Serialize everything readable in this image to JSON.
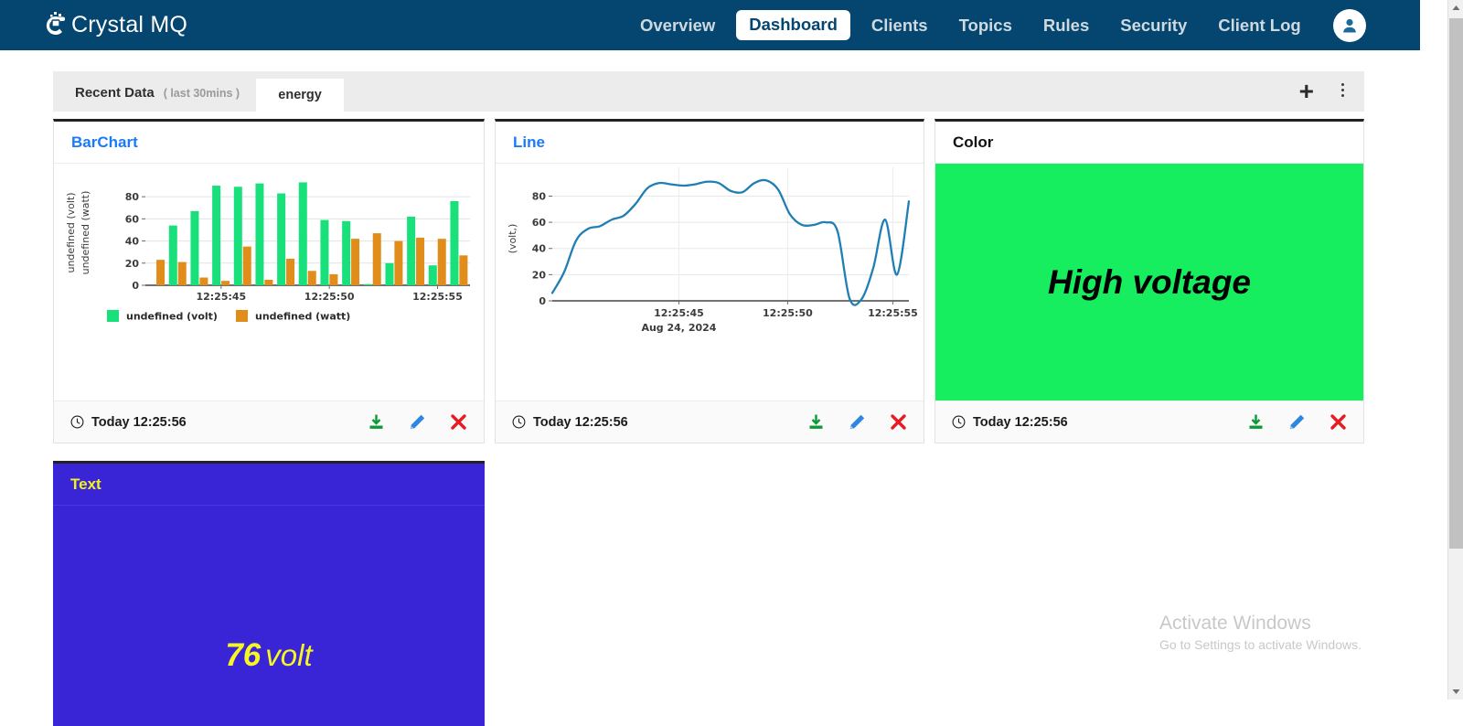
{
  "app": {
    "brand": "Crystal MQ",
    "logo_icon": "crystal-logo-icon"
  },
  "nav": {
    "items": [
      {
        "label": "Overview",
        "active": false
      },
      {
        "label": "Dashboard",
        "active": true
      },
      {
        "label": "Clients",
        "active": false
      },
      {
        "label": "Topics",
        "active": false
      },
      {
        "label": "Rules",
        "active": false
      },
      {
        "label": "Security",
        "active": false
      },
      {
        "label": "Client Log",
        "active": false
      }
    ],
    "avatar_icon": "user-avatar-icon"
  },
  "tabstrip": {
    "recent_label": "Recent Data",
    "recent_range": "( last 30mins )",
    "tabs": [
      {
        "label": "energy",
        "active": true
      }
    ],
    "add_icon": "plus-icon",
    "menu_icon": "kebab-menu-icon"
  },
  "cards": {
    "bar": {
      "title": "BarChart",
      "timestamp": "Today 12:25:56",
      "clock_icon": "clock-icon",
      "download_icon": "download-icon",
      "edit_icon": "pencil-icon",
      "delete_icon": "close-x-icon"
    },
    "line": {
      "title": "Line",
      "timestamp": "Today 12:25:56",
      "clock_icon": "clock-icon",
      "download_icon": "download-icon",
      "edit_icon": "pencil-icon",
      "delete_icon": "close-x-icon"
    },
    "color": {
      "title": "Color",
      "value_text": "High voltage",
      "background_color": "#16ed5f",
      "timestamp": "Today 12:25:56",
      "clock_icon": "clock-icon",
      "download_icon": "download-icon",
      "edit_icon": "pencil-icon",
      "delete_icon": "close-x-icon"
    },
    "text": {
      "title": "Text",
      "value": "76",
      "unit": "volt",
      "background_color": "#3a25d6",
      "title_color": "#f3f31c"
    }
  },
  "watermark": {
    "line1": "Activate Windows",
    "line2": "Go to Settings to activate Windows."
  },
  "chart_data": [
    {
      "id": "barchart",
      "type": "bar",
      "title": "BarChart",
      "xlabel": "",
      "ylabel": "undefined (volt)  undefined (watt)",
      "ylabels": [
        "undefined (volt)",
        "undefined (watt)"
      ],
      "ylim": [
        0,
        95
      ],
      "yticks": [
        0,
        20,
        40,
        60,
        80
      ],
      "grid": true,
      "legend": [
        "undefined (volt)",
        "undefined (watt)"
      ],
      "legend_position": "bottom",
      "xtick_labels": [
        "12:25:45",
        "12:25:50",
        "12:25:55"
      ],
      "xtick_indices": [
        3,
        8,
        13
      ],
      "categories": [
        "1",
        "2",
        "3",
        "4",
        "5",
        "6",
        "7",
        "8",
        "9",
        "10",
        "11",
        "12",
        "13",
        "14",
        "15"
      ],
      "series": [
        {
          "name": "undefined (volt)",
          "color": "#18e07a",
          "values": [
            0,
            54,
            67,
            90,
            89,
            92,
            83,
            93,
            59,
            58,
            1,
            20,
            62,
            18,
            76
          ]
        },
        {
          "name": "undefined (watt)",
          "color": "#e08d1b",
          "values": [
            23,
            21,
            7,
            4,
            35,
            5,
            24,
            13,
            10,
            42,
            47,
            40,
            43,
            42,
            27
          ]
        }
      ]
    },
    {
      "id": "linechart",
      "type": "line",
      "title": "Line",
      "ylabel": "(volt,)",
      "xlabel": "Aug 24, 2024",
      "ylim": [
        0,
        95
      ],
      "yticks": [
        0,
        20,
        40,
        60,
        80
      ],
      "grid": true,
      "xtick_labels": [
        "12:25:45",
        "12:25:50",
        "12:25:55"
      ],
      "line_color": "#1f7fb5",
      "x": [
        0,
        1,
        2,
        3,
        4,
        5,
        6,
        7,
        8,
        9,
        10,
        11,
        12,
        13,
        14,
        15,
        16,
        17,
        18,
        19,
        20,
        21,
        22,
        23,
        24,
        25,
        26,
        27,
        28,
        29
      ],
      "values": [
        6,
        22,
        46,
        55,
        57,
        62,
        65,
        74,
        86,
        90,
        89,
        88,
        89,
        91,
        90,
        84,
        83,
        90,
        92,
        85,
        66,
        58,
        58,
        60,
        53,
        2,
        1,
        25,
        62,
        20,
        76
      ]
    }
  ]
}
